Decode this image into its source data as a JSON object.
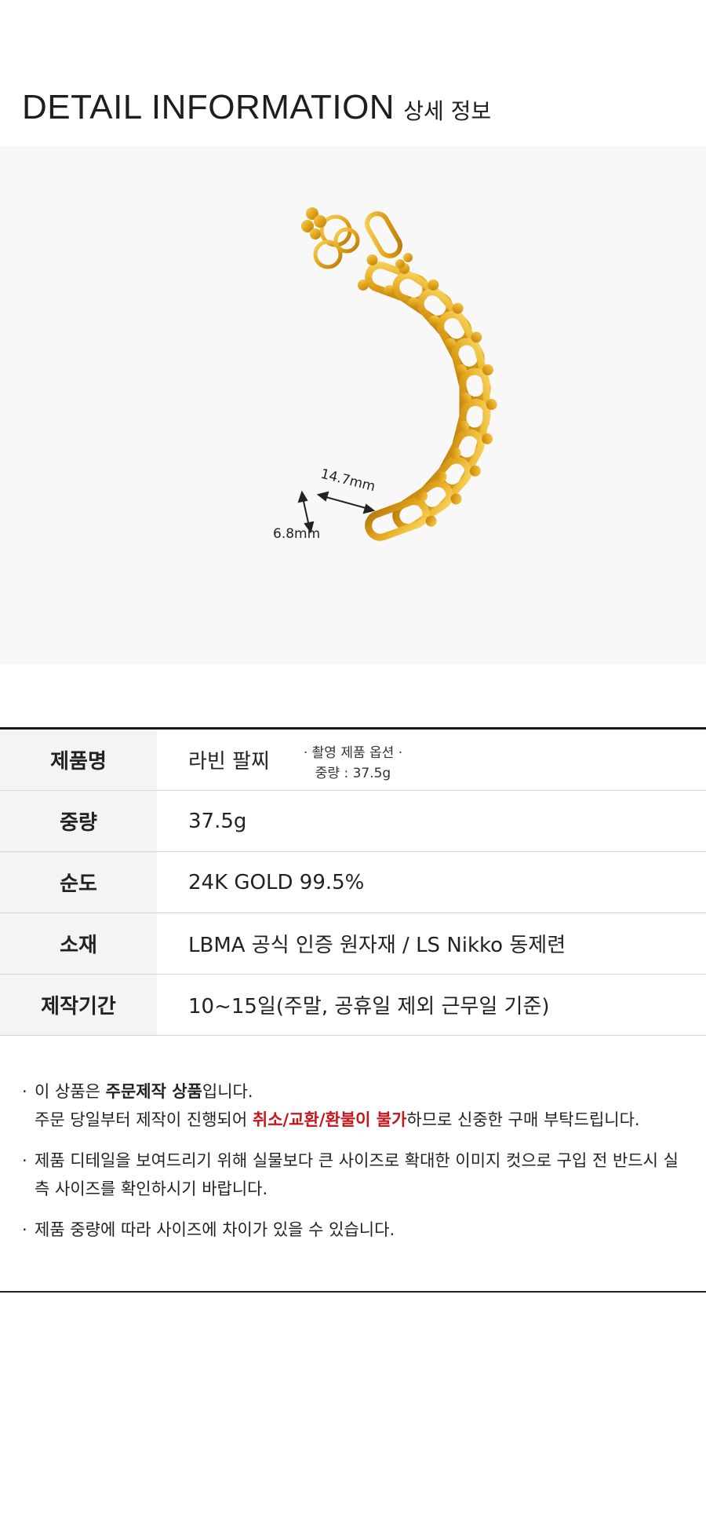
{
  "header": {
    "title_en": "DETAIL INFORMATION",
    "title_ko": "상세 정보"
  },
  "photo": {
    "dimension_width": "14.7mm",
    "dimension_height": "6.8mm",
    "caption_option": "· 촬영 제품 옵션 ·",
    "caption_weight": "중량 : 37.5g",
    "gold_color": "#e3a51c",
    "background_color": "#f8f8f8"
  },
  "spec_table": {
    "rows": [
      {
        "label": "제품명",
        "value": "라빈 팔찌"
      },
      {
        "label": "중량",
        "value": "37.5g"
      },
      {
        "label": "순도",
        "value": "24K GOLD 99.5%"
      },
      {
        "label": "소재",
        "value": "LBMA 공식 인증 원자재 / LS Nikko 동제련"
      },
      {
        "label": "제작기간",
        "value": "10~15일(주말, 공휴일 제외 근무일 기준)"
      }
    ]
  },
  "notes": {
    "bullet": "·",
    "n1_pre": "이 상품은 ",
    "n1_bold": "주문제작 상품",
    "n1_post": "입니다.",
    "n1_line2_pre": "주문 당일부터 제작이 진행되어 ",
    "n1_line2_warn": "취소/교환/환불이 불가",
    "n1_line2_post": "하므로 신중한 구매 부탁드립니다.",
    "n2": "제품 디테일을 보여드리기 위해 실물보다 큰 사이즈로 확대한 이미지 컷으로 구입 전 반드시 실측 사이즈를 확인하시기 바랍니다.",
    "n3": " 제품 중량에 따라 사이즈에 차이가 있을 수 있습니다.",
    "warn_color": "#c4161c"
  }
}
